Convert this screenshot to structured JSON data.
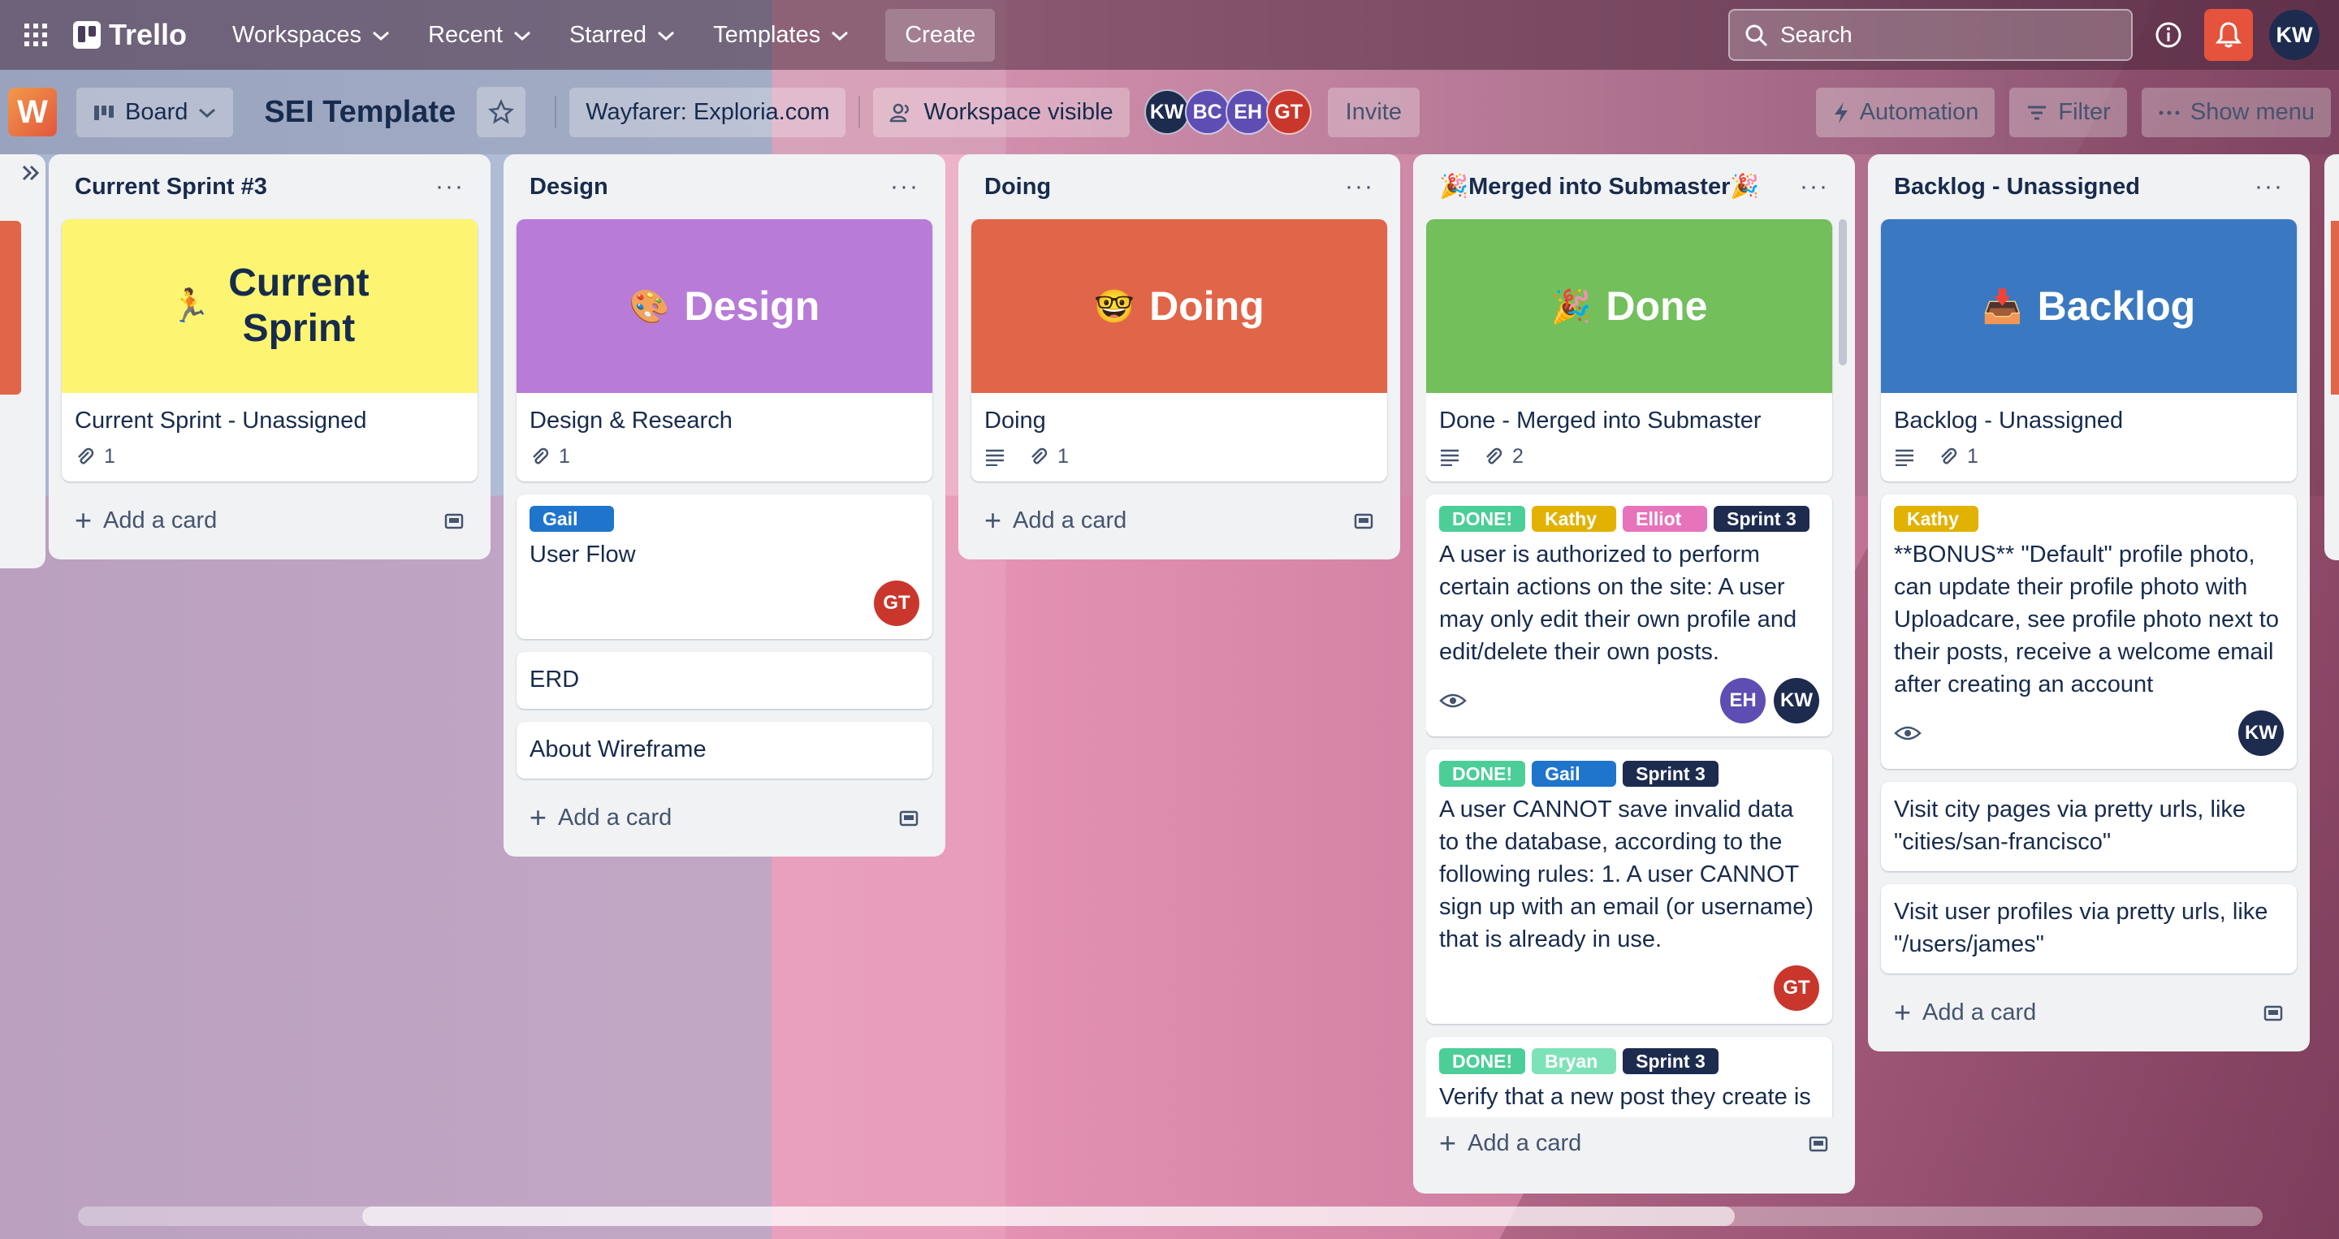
{
  "topnav": {
    "logo": "Trello",
    "menus": [
      "Workspaces",
      "Recent",
      "Starred",
      "Templates"
    ],
    "create": "Create",
    "search_placeholder": "Search",
    "user_initials": "KW"
  },
  "board": {
    "view": "Board",
    "title": "SEI Template",
    "workspace": "Wayfarer: Exploria.com",
    "visibility": "Workspace visible",
    "members": [
      "KW",
      "BC",
      "EH",
      "GT"
    ],
    "invite": "Invite",
    "automation": "Automation",
    "filter": "Filter",
    "show_menu": "Show menu",
    "workspace_badge": "W"
  },
  "lists": [
    {
      "title": "Current Sprint #3",
      "cover_text": "Current Sprint",
      "cover_line1": "Current",
      "cover_line2": "Sprint",
      "cover_emoji": "🏃",
      "cover_color": "#fdf571",
      "card_title": "Current Sprint - Unassigned",
      "attachments": "1",
      "add": "Add a card"
    },
    {
      "title": "Design",
      "cover_text": "Design",
      "cover_emoji": "🎨",
      "cover_color": "#b87bd8",
      "card_title": "Design & Research",
      "attachments": "1",
      "cards": [
        {
          "label": "Gail",
          "title": "User Flow",
          "avatar": "GT"
        },
        {
          "title": "ERD"
        },
        {
          "title": "About Wireframe"
        }
      ],
      "add": "Add a card"
    },
    {
      "title": "Doing",
      "cover_text": "Doing",
      "cover_emoji": "🤓",
      "cover_color": "#e16548",
      "card_title": "Doing",
      "attachments": "1",
      "add": "Add a card"
    },
    {
      "title": "🎉Merged into Submaster🎉",
      "cover_text": "Done",
      "cover_emoji": "🎉",
      "cover_color": "#72bf5c",
      "card_title": "Done - Merged into Submaster",
      "attachments": "2",
      "cards": [
        {
          "labels": [
            "DONE!",
            "Kathy",
            "Elliot",
            "Sprint 3"
          ],
          "title": "A user is authorized to perform certain actions on the site: A user may only edit their own profile and edit/delete their own posts.",
          "avatars": [
            "EH",
            "KW"
          ]
        },
        {
          "labels": [
            "DONE!",
            "Gail",
            "Sprint 3"
          ],
          "title": "A user CANNOT save invalid data to the database, according to the following rules: 1. A user CANNOT sign up with an email (or username) that is already in use.",
          "avatars": [
            "GT"
          ]
        },
        {
          "labels": [
            "DONE!",
            "Bryan",
            "Sprint 3"
          ],
          "title": "Verify that a new post they create is"
        }
      ],
      "add": "Add a card"
    },
    {
      "title": "Backlog - Unassigned",
      "cover_text": "Backlog",
      "cover_emoji": "📥",
      "cover_color": "#3a79c1",
      "card_title": "Backlog - Unassigned",
      "attachments": "1",
      "cards": [
        {
          "label": "Kathy",
          "title": "**BONUS** \"Default\" profile photo, can update their profile photo with Uploadcare, see profile photo next to their posts, receive a welcome email after creating an account",
          "avatar": "KW"
        },
        {
          "title": "Visit city pages via pretty urls, like \"cities/san-francisco\""
        },
        {
          "title": "Visit user profiles via pretty urls, like \"/users/james\""
        }
      ],
      "add": "Add a card"
    }
  ],
  "colors": {
    "done": "#4bce97",
    "kathy": "#e2b203",
    "elliot": "#e774bb",
    "sprint": "#1d2b4f",
    "gail": "#1f75cb",
    "bryan": "#4bce97",
    "gt": "#c9372c",
    "eh": "#5e4db2",
    "kw": "#1d2b4f",
    "bc": "#5e4db2"
  }
}
